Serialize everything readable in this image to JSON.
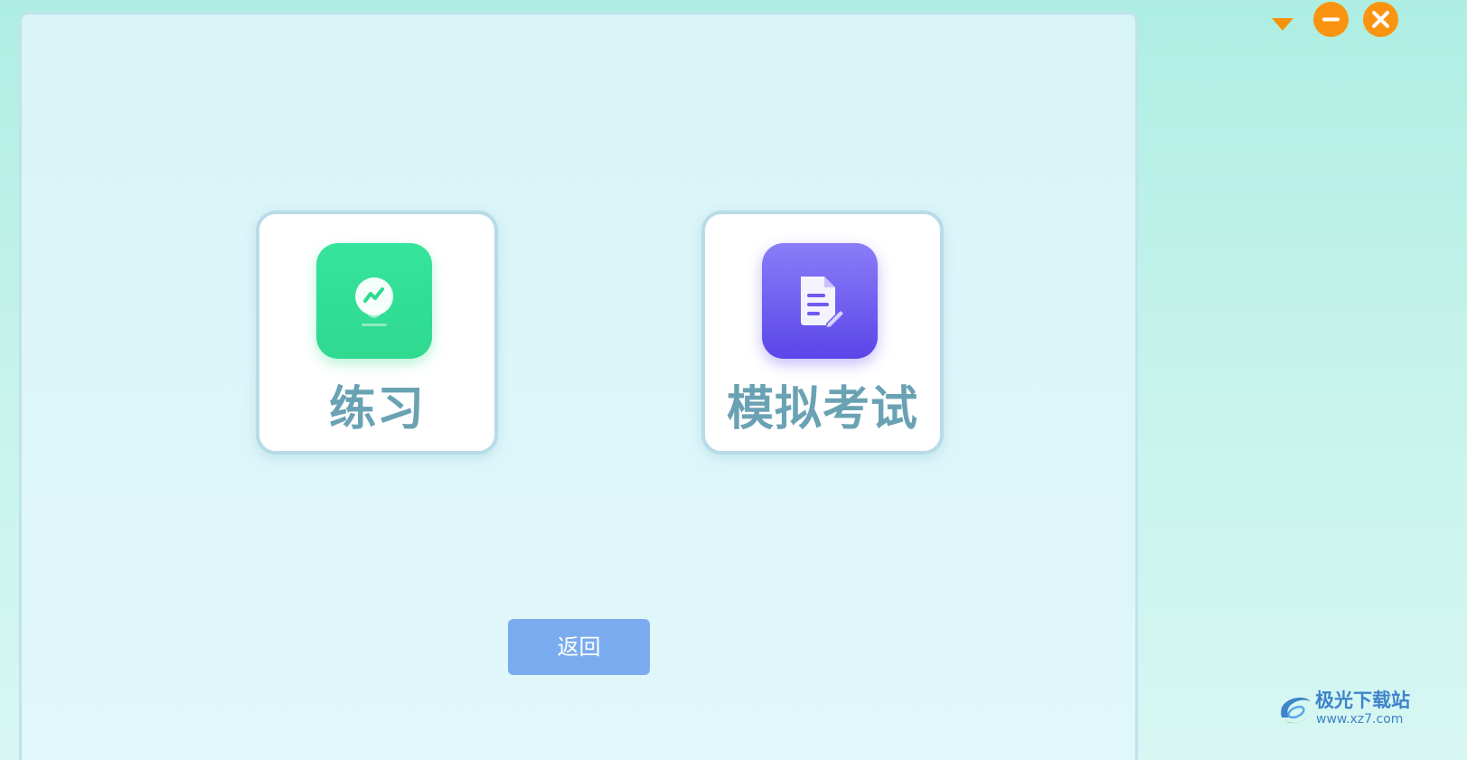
{
  "window_controls": {
    "dropdown_icon": "triangle-down-icon",
    "minimize_icon": "minus-circle-icon",
    "close_icon": "x-circle-icon",
    "accent_color": "#fa9410"
  },
  "main": {
    "cards": [
      {
        "label": "练习",
        "icon": "lightbulb-icon",
        "color": "#34e096"
      },
      {
        "label": "模拟考试",
        "icon": "document-edit-icon",
        "color": "#6c5cf0"
      }
    ],
    "back_button_label": "返回"
  },
  "watermark": {
    "site_name": "极光下载站",
    "url": "www.xz7.com"
  }
}
